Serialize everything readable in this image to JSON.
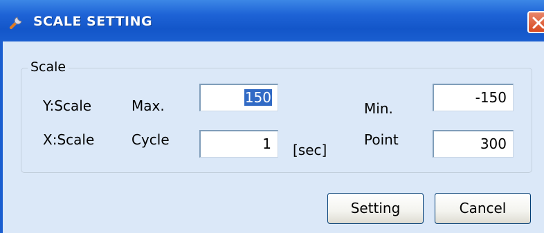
{
  "window": {
    "title": "SCALE SETTING",
    "title_icon": "wrench-icon",
    "close_icon": "close-icon"
  },
  "group": {
    "legend": "Scale"
  },
  "rows": {
    "y": {
      "label": "Y:Scale",
      "max_label": "Max.",
      "max_value": "150",
      "min_label": "Min.",
      "min_value": "-150"
    },
    "x": {
      "label": "X:Scale",
      "cycle_label": "Cycle",
      "cycle_value": "1",
      "unit": "[sec]",
      "point_label": "Point",
      "point_value": "300"
    }
  },
  "buttons": {
    "setting": "Setting",
    "cancel": "Cancel"
  },
  "colors": {
    "titlebar": "#1e63d6",
    "client": "#dbe8f8",
    "selection": "#316ac5",
    "close": "#d84a20"
  }
}
